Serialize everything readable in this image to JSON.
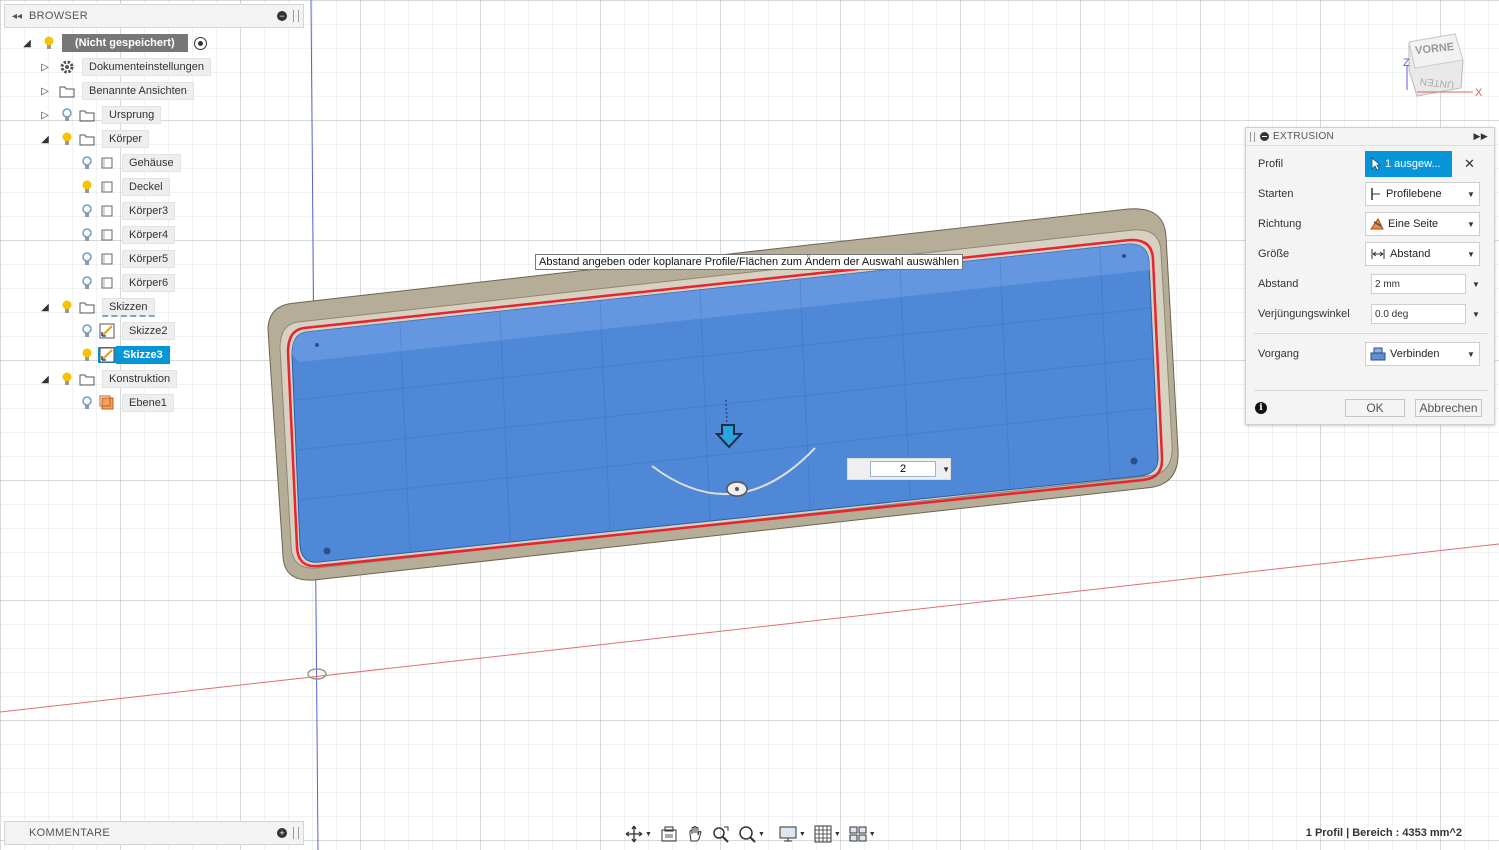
{
  "browser": {
    "title": "BROWSER",
    "root_label": "(Nicht gespeichert)",
    "items": [
      {
        "label": "Dokumenteinstellungen"
      },
      {
        "label": "Benannte Ansichten"
      },
      {
        "label": "Ursprung"
      },
      {
        "label": "Körper"
      },
      {
        "label": "Gehäuse"
      },
      {
        "label": "Deckel"
      },
      {
        "label": "Körper3"
      },
      {
        "label": "Körper4"
      },
      {
        "label": "Körper5"
      },
      {
        "label": "Körper6"
      },
      {
        "label": "Skizzen"
      },
      {
        "label": "Skizze2"
      },
      {
        "label": "Skizze3"
      },
      {
        "label": "Konstruktion"
      },
      {
        "label": "Ebene1"
      }
    ]
  },
  "comments": {
    "title": "KOMMENTARE"
  },
  "tooltip": "Abstand angeben oder koplanare Profile/Flächen zum Ändern der Auswahl auswählen",
  "distance_input": {
    "value": "2"
  },
  "viewcube": {
    "front": "VORNE",
    "bottom": "UNTEN",
    "axis_x": "X",
    "axis_z": "Z"
  },
  "dialog": {
    "title": "EXTRUSION",
    "rows": {
      "profil": {
        "label": "Profil",
        "value": "1 ausgew..."
      },
      "starten": {
        "label": "Starten",
        "value": "Profilebene"
      },
      "richtung": {
        "label": "Richtung",
        "value": "Eine Seite"
      },
      "groesse": {
        "label": "Größe",
        "value": "Abstand"
      },
      "abstand": {
        "label": "Abstand",
        "value": "2 mm"
      },
      "winkel": {
        "label": "Verjüngungswinkel",
        "value": "0.0 deg"
      },
      "vorgang": {
        "label": "Vorgang",
        "value": "Verbinden"
      }
    },
    "ok": "OK",
    "cancel": "Abbrechen"
  },
  "status": "1 Profil | Bereich : 4353 mm^2",
  "colors": {
    "accent": "#0696d7",
    "profile_fill": "#3f7fd9",
    "body": "#b3a993",
    "edge_red": "#e8242f",
    "bulb_on": "#f7c300",
    "bulb_off": "#6b9cc8"
  }
}
